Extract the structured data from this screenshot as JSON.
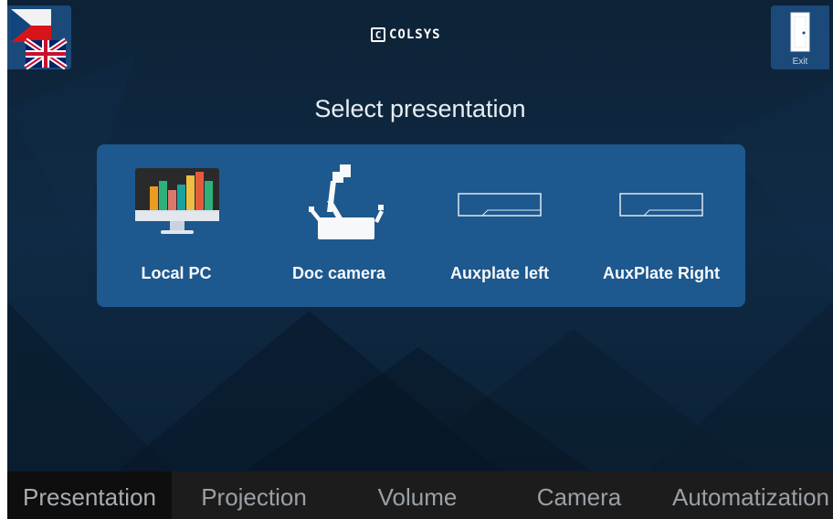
{
  "header": {
    "logo_mark": "C",
    "logo_text": "COLSYS",
    "language_icon": "flag-cz-uk-icon",
    "exit_label": "Exit",
    "exit_icon": "door-icon"
  },
  "main": {
    "title": "Select presentation",
    "sources": [
      {
        "label": "Local PC",
        "icon": "monitor-chart-icon"
      },
      {
        "label": "Doc camera",
        "icon": "document-camera-icon"
      },
      {
        "label": "Auxplate left",
        "icon": "wall-plate-icon"
      },
      {
        "label": "AuxPlate Right",
        "icon": "wall-plate-icon"
      }
    ]
  },
  "tabs": [
    {
      "label": "Presentation",
      "active": true
    },
    {
      "label": "Projection",
      "active": false
    },
    {
      "label": "Volume",
      "active": false
    },
    {
      "label": "Camera",
      "active": false
    },
    {
      "label": "Automatization",
      "active": false
    }
  ],
  "colors": {
    "background": "#0f2a44",
    "panel": "#1e5a92",
    "header_button": "#1b4a7a",
    "tab_bar": "#1c1c1c",
    "tab_active": "#0e0e0e"
  }
}
